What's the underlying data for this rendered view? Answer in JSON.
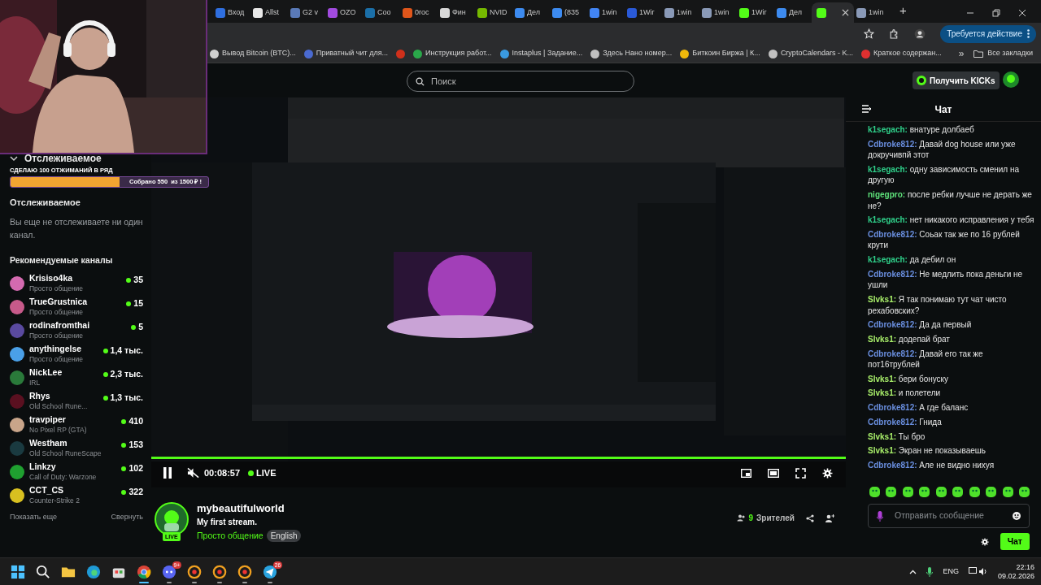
{
  "browser": {
    "tabs": [
      {
        "label": "Вход",
        "color": "#2f6fe0",
        "selected": false
      },
      {
        "label": "Allst",
        "color": "#e8e8e8",
        "selected": false
      },
      {
        "label": "G2 v",
        "color": "#5a7ab8",
        "selected": false
      },
      {
        "label": "OZO",
        "color": "#a24be0",
        "selected": false
      },
      {
        "label": "Coo",
        "color": "#1b6fa8",
        "selected": false
      },
      {
        "label": "0roc",
        "color": "#e0561b",
        "selected": false
      },
      {
        "label": "Фин",
        "color": "#d8d8d8",
        "selected": false
      },
      {
        "label": "NVID",
        "color": "#76b900",
        "selected": false
      },
      {
        "label": "Дел",
        "color": "#3d8bf0",
        "selected": false
      },
      {
        "label": "(835",
        "color": "#3d8bf0",
        "selected": false
      },
      {
        "label": "1win",
        "color": "#4285f4",
        "selected": false
      },
      {
        "label": "1Wir",
        "color": "#2a5ad8",
        "selected": false
      },
      {
        "label": "1win",
        "color": "#8a9ab8",
        "selected": false
      },
      {
        "label": "1win",
        "color": "#8a9ab8",
        "selected": false
      },
      {
        "label": "1Wir",
        "color": "#53fc18",
        "selected": false
      },
      {
        "label": "Дел",
        "color": "#3d8bf0",
        "selected": false
      },
      {
        "color": "#53fc18",
        "selected": true
      },
      {
        "label": "1win",
        "color": "#8a9ab8",
        "selected": false
      }
    ],
    "new_tab": "+",
    "action_button": "Требуется действие",
    "bookmarks": [
      {
        "label": "Вывод Bitcoin (BTC)...",
        "color": "#d0d0d0"
      },
      {
        "label": "Приватный чит для...",
        "color": "#4a6ad0"
      },
      {
        "color": "#d0301b"
      },
      {
        "label": "Инструкция работ...",
        "color": "#2aa84a"
      },
      {
        "label": "Instaplus | Задание...",
        "color": "#3a9ae0"
      },
      {
        "label": "Здесь Нано номер...",
        "color": "#c0c0c0"
      },
      {
        "label": "Биткоин Биржа | К...",
        "color": "#f0b90b"
      },
      {
        "label": "CryptoCalendars - K...",
        "color": "#c0c0c0"
      },
      {
        "label": "Краткое содержан...",
        "color": "#e03030"
      }
    ],
    "bookmarks_more": "»",
    "all_bookmarks": "Все закладки"
  },
  "header": {
    "search_placeholder": "Поиск",
    "kicks_button": "Получить KICKs"
  },
  "stream_overlay": {
    "goal_title": "СДЕЛАЮ 100 ОТЖИМАНИЙ В РЯД",
    "goal_text": "Собрано 550  из 1500 ₽ !",
    "level": 0.55
  },
  "sidebar": {
    "following_header": "Отслеживаемое",
    "following_title": "Отслеживаемое",
    "empty_text": "Вы еще не отслеживаете ни один канал.",
    "recommended_title": "Рекомендуемые каналы",
    "channels": [
      {
        "name": "Krisiso4ka",
        "category": "Просто общение",
        "viewers": "35",
        "color": "#d46ab0"
      },
      {
        "name": "TrueGrustnica",
        "category": "Просто общение",
        "viewers": "15",
        "color": "#c75a8a"
      },
      {
        "name": "rodinafromthai",
        "category": "Просто общение",
        "viewers": "5",
        "color": "#5a4aa0"
      },
      {
        "name": "anythingelse",
        "category": "Просто общение",
        "viewers": "1,4 тыс.",
        "color": "#4aa0e8"
      },
      {
        "name": "NickLee",
        "category": "IRL",
        "viewers": "2,3 тыс.",
        "color": "#2a7a3a"
      },
      {
        "name": "Rhys",
        "category": "Old School Rune...",
        "viewers": "1,3 тыс.",
        "color": "#5a1020"
      },
      {
        "name": "travpiper",
        "category": "No Pixel RP (GTA)",
        "viewers": "410",
        "color": "#c9a58a"
      },
      {
        "name": "Westham",
        "category": "Old School RuneScape",
        "viewers": "153",
        "color": "#1a3a40"
      },
      {
        "name": "Linkzy",
        "category": "Call of Duty: Warzone",
        "viewers": "102",
        "color": "#1fa030"
      },
      {
        "name": "CCT_CS",
        "category": "Counter-Strike 2",
        "viewers": "322",
        "color": "#d8c020"
      }
    ],
    "show_more": "Показать еще",
    "collapse": "Свернуть"
  },
  "player": {
    "time": "00:08:57",
    "live": "LIVE"
  },
  "stream": {
    "name": "mybeautifulworld",
    "title": "My first stream.",
    "category": "Просто общение",
    "tag": "English",
    "live_badge": "LIVE",
    "viewers": "9",
    "viewers_label": "Зрителей"
  },
  "chat": {
    "title": "Чат",
    "messages": [
      {
        "user": "k1segach:",
        "color": "#2fd08a",
        "text": "внатуре долбаеб"
      },
      {
        "user": "Cdbroke812:",
        "color": "#6a8fe0",
        "text": "Давай dog house или уже докручивпй этот"
      },
      {
        "user": "k1segach:",
        "color": "#2fd08a",
        "text": "одну зависимость сменил на другую"
      },
      {
        "user": "nigegpro:",
        "color": "#5ee07a",
        "text": "после ребки лучше не дерать же не?"
      },
      {
        "user": "k1segach:",
        "color": "#2fd08a",
        "text": "нет никакого исправления у тебя"
      },
      {
        "user": "Cdbroke812:",
        "color": "#6a8fe0",
        "text": "Соьак так же по 16 рублей крути"
      },
      {
        "user": "k1segach:",
        "color": "#2fd08a",
        "text": "да дебил он"
      },
      {
        "user": "Cdbroke812:",
        "color": "#6a8fe0",
        "text": "Не медлить пока деньги не ушли"
      },
      {
        "user": "Slvks1:",
        "color": "#a8ee6a",
        "text": "Я так понимаю тут чат чисто рехабовских?"
      },
      {
        "user": "Cdbroke812:",
        "color": "#6a8fe0",
        "text": "Да да первый"
      },
      {
        "user": "Slvks1:",
        "color": "#a8ee6a",
        "text": "додепай брат"
      },
      {
        "user": "Cdbroke812:",
        "color": "#6a8fe0",
        "text": "Давай его так же пот16трублей"
      },
      {
        "user": "Slvks1:",
        "color": "#a8ee6a",
        "text": "бери бонуску"
      },
      {
        "user": "Slvks1:",
        "color": "#a8ee6a",
        "text": "и полетели"
      },
      {
        "user": "Cdbroke812:",
        "color": "#6a8fe0",
        "text": "А где баланс"
      },
      {
        "user": "Cdbroke812:",
        "color": "#6a8fe0",
        "text": "Гнида"
      },
      {
        "user": "Slvks1:",
        "color": "#a8ee6a",
        "text": "Ты бро"
      },
      {
        "user": "Slvks1:",
        "color": "#a8ee6a",
        "text": "Экран не показываешь"
      },
      {
        "user": "Cdbroke812:",
        "color": "#6a8fe0",
        "text": "Але не видно нихуя"
      }
    ],
    "input_placeholder": "Отправить сообщение",
    "send_button": "Чат"
  },
  "taskbar": {
    "apps": [
      {
        "kind": "windows"
      },
      {
        "kind": "search"
      },
      {
        "kind": "folder"
      },
      {
        "kind": "edge"
      },
      {
        "kind": "store"
      },
      {
        "kind": "chrome",
        "selected": true
      },
      {
        "kind": "discord",
        "badge": "9+",
        "selected": false
      },
      {
        "kind": "app",
        "selected": false
      },
      {
        "kind": "app",
        "selected": false
      },
      {
        "kind": "app",
        "selected": false
      },
      {
        "kind": "telegram",
        "badge": "26",
        "selected": false
      }
    ],
    "language": "ENG",
    "time": "22:16",
    "date": "09.02.2026"
  }
}
